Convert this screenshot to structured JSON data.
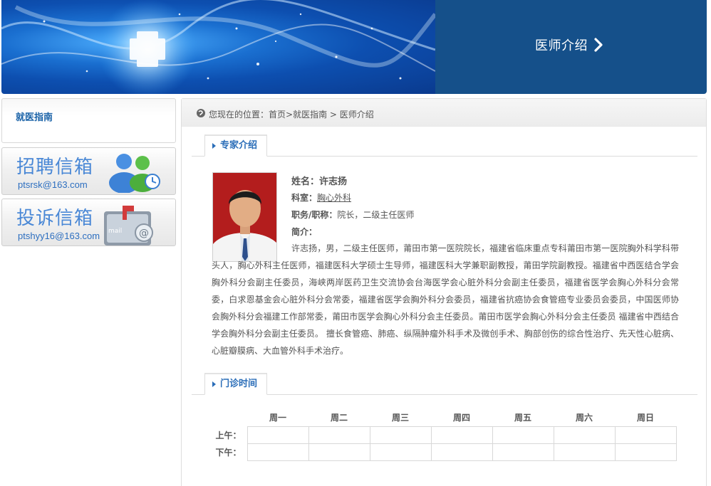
{
  "banner": {
    "title": "医师介绍"
  },
  "sidebar": {
    "guide_title": "就医指南",
    "recruit": {
      "title": "招聘信箱",
      "email": "ptsrsk@163.com"
    },
    "complaint": {
      "title": "投诉信箱",
      "email": "ptshyy16@163.com"
    }
  },
  "breadcrumb": {
    "prefix": "您现在的位置：",
    "home": "首页",
    "section": "就医指南",
    "page": "医师介绍",
    "sep1": ">",
    "sep2": " > "
  },
  "expert": {
    "tab_label": "专家介绍",
    "name_label": "姓名：",
    "name": "许志扬",
    "dept_label": "科室：",
    "dept": "胸心外科",
    "title_label": "职务/职称：",
    "title": "院长，二级主任医师",
    "intro_label": "简介：",
    "bio": "许志扬，男，二级主任医师，莆田市第一医院院长，福建省临床重点专科莆田市第一医院胸外科学科带头人，胸心外科主任医师，福建医科大学硕士生导师，福建医科大学兼职副教授，莆田学院副教授。福建省中西医结合学会胸外科分会副主任委员，海峡两岸医药卫生交流协会台海医学会心脏外科分会副主任委员，福建省医学会胸心外科分会常委，白求恩基金会心脏外科分会常委，福建省医学会胸外科分会委员，福建省抗癌协会食管癌专业委员会委员，中国医师协会胸外科分会福建工作部常委，莆田市医学会胸心外科分会主任委员。莆田市医学会胸心外科分会主任委员 福建省中西结合学会胸外科分会副主任委员。 擅长食管癌、肺癌、纵隔肿瘤外科手术及微创手术、胸部创伤的综合性治疗、先天性心脏病、心脏瓣膜病、大血管外科手术治疗。"
  },
  "schedule": {
    "tab_label": "门诊时间",
    "days": [
      "周一",
      "周二",
      "周三",
      "周四",
      "周五",
      "周六",
      "周日"
    ],
    "rows": [
      {
        "label": "上午："
      },
      {
        "label": "下午："
      }
    ]
  },
  "colors": {
    "banner_title_bg": "#15508a",
    "accent_blue": "#2a6db8",
    "mailbox_title": "#4a88d6"
  }
}
